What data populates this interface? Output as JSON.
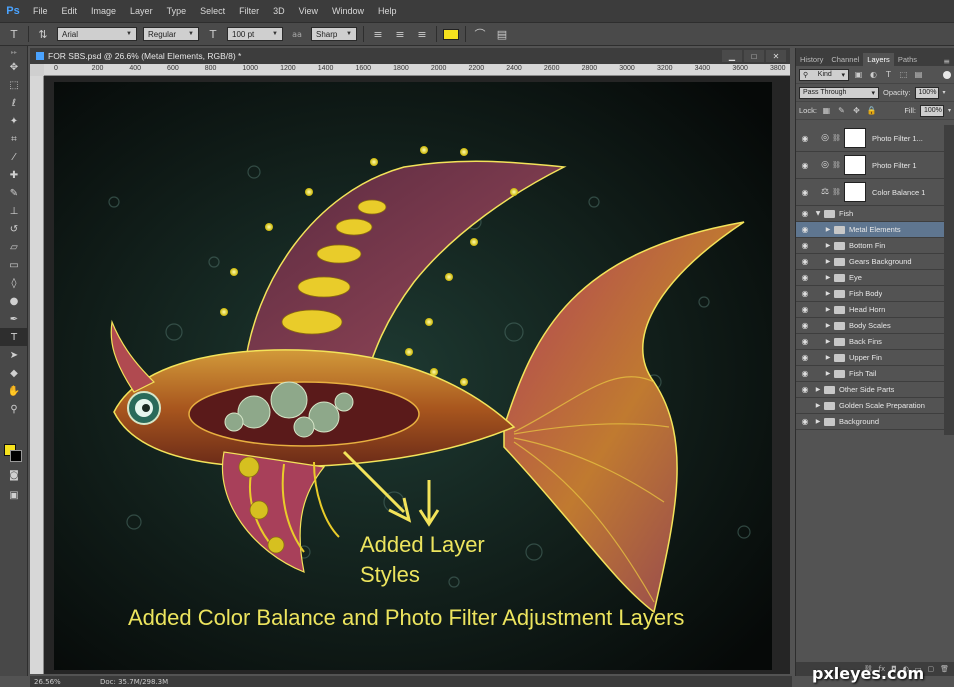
{
  "app": {
    "logo": "Ps"
  },
  "menu": [
    "File",
    "Edit",
    "Image",
    "Layer",
    "Type",
    "Select",
    "Filter",
    "3D",
    "View",
    "Window",
    "Help"
  ],
  "options": {
    "tool_icon": "text-tool-icon",
    "font_family": "Arial",
    "font_style": "Regular",
    "font_size": "100 pt",
    "aa_label": "aa",
    "antialias": "Sharp",
    "text_color": "#f6e21e"
  },
  "document": {
    "title": "FOR SBS.psd @ 26.6% (Metal Elements, RGB/8) *",
    "ruler_top": [
      "0",
      "200",
      "400",
      "600",
      "800",
      "1000",
      "1200",
      "1400",
      "1600",
      "1800",
      "2000",
      "2200",
      "2400",
      "2600",
      "2800",
      "3000",
      "3200",
      "3400",
      "3600",
      "3800"
    ]
  },
  "canvas": {
    "annotation_1_line1": "Added Layer",
    "annotation_1_line2": "Styles",
    "annotation_2": "Added Color Balance and Photo Filter Adjustment Layers"
  },
  "status": {
    "zoom": "26.56%",
    "doc": "Doc: 35.7M/298.3M"
  },
  "panel": {
    "tabs": [
      "History",
      "Channel",
      "Layers",
      "Paths"
    ],
    "active_tab": "Layers",
    "kind_label": "Kind",
    "blend_mode": "Pass Through",
    "opacity_label": "Opacity:",
    "opacity_value": "100%",
    "lock_label": "Lock:",
    "fill_label": "Fill:",
    "fill_value": "100%",
    "layers": [
      {
        "name": "Photo Filter 1...",
        "kind": "adjustment",
        "icon": "photo-filter-icon",
        "visible": true
      },
      {
        "name": "Photo Filter 1",
        "kind": "adjustment",
        "icon": "photo-filter-icon",
        "visible": true
      },
      {
        "name": "Color Balance 1",
        "kind": "adjustment",
        "icon": "color-balance-icon",
        "visible": true
      },
      {
        "name": "Fish",
        "kind": "group-open",
        "visible": true
      },
      {
        "name": "Metal Elements",
        "kind": "subgroup",
        "visible": true,
        "selected": true
      },
      {
        "name": "Bottom Fin",
        "kind": "subgroup",
        "visible": true
      },
      {
        "name": "Gears Background",
        "kind": "subgroup",
        "visible": true
      },
      {
        "name": "Eye",
        "kind": "subgroup",
        "visible": true
      },
      {
        "name": "Fish Body",
        "kind": "subgroup",
        "visible": true
      },
      {
        "name": "Head Horn",
        "kind": "subgroup",
        "visible": true
      },
      {
        "name": "Body Scales",
        "kind": "subgroup",
        "visible": true
      },
      {
        "name": "Back Fins",
        "kind": "subgroup",
        "visible": true
      },
      {
        "name": "Upper Fin",
        "kind": "subgroup",
        "visible": true
      },
      {
        "name": "Fish Tail",
        "kind": "subgroup",
        "visible": true
      },
      {
        "name": "Other Side Parts",
        "kind": "group",
        "visible": true
      },
      {
        "name": "Golden Scale Preparation",
        "kind": "group",
        "visible": false
      },
      {
        "name": "Background",
        "kind": "group",
        "visible": true
      }
    ]
  },
  "watermark": "pxleyes.com"
}
